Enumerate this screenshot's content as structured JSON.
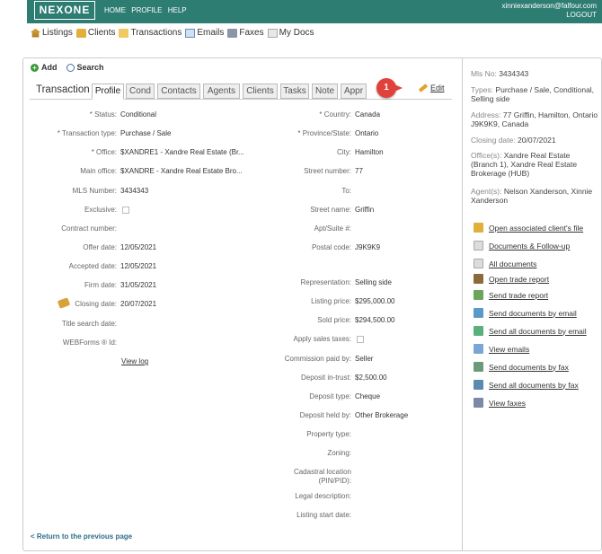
{
  "topbar": {
    "logo": "NEXONE",
    "nav": [
      "HOME",
      "PROFILE",
      "HELP"
    ],
    "user_email": "xinniexanderson@falfour.com",
    "logout": "LOGOUT",
    "bg_color": "#2e7d73"
  },
  "subnav": [
    {
      "label": "Listings",
      "icon": "house-icon"
    },
    {
      "label": "Clients",
      "icon": "clients-icon"
    },
    {
      "label": "Transactions",
      "icon": "folder-icon"
    },
    {
      "label": "Emails",
      "icon": "mail-icon"
    },
    {
      "label": "Faxes",
      "icon": "fax-icon"
    },
    {
      "label": "My Docs",
      "icon": "docs-icon"
    }
  ],
  "tools": {
    "add": "Add",
    "search": "Search"
  },
  "tabs": {
    "title": "Transaction",
    "items": [
      "Profile",
      "Cond",
      "Contacts",
      "Agents",
      "Clients",
      "Tasks",
      "Note",
      "Appr"
    ],
    "active": "Profile"
  },
  "callout": {
    "number": "1",
    "color": "#e0413b"
  },
  "edit_label": "Edit",
  "left_fields": {
    "status": {
      "label": "* Status:",
      "value": "Conditional"
    },
    "transaction_type": {
      "label": "* Transaction type:",
      "value": "Purchase / Sale"
    },
    "office": {
      "label": "* Office:",
      "value": "$XANDRE1 - Xandre Real Estate (Br..."
    },
    "main_office": {
      "label": "Main office:",
      "value": "$XANDRE - Xandre Real Estate Bro..."
    },
    "mls_number": {
      "label": "MLS Number:",
      "value": "3434343"
    },
    "exclusive": {
      "label": "Exclusive:"
    },
    "contract_number": {
      "label": "Contract number:"
    },
    "offer_date": {
      "label": "Offer date:",
      "value": "12/05/2021"
    },
    "accepted_date": {
      "label": "Accepted date:",
      "value": "12/05/2021"
    },
    "firm_date": {
      "label": "Firm date:",
      "value": "31/05/2021"
    },
    "closing_date": {
      "label": "Closing date:",
      "value": "20/07/2021"
    },
    "title_search_date": {
      "label": "Title search date:"
    },
    "webforms_id": {
      "label": "WEBForms ® Id:"
    }
  },
  "view_log": "View log",
  "right_fields": {
    "country": {
      "label": "* Country:",
      "value": "Canada"
    },
    "province": {
      "label": "* Province/State:",
      "value": "Ontario"
    },
    "city": {
      "label": "City:",
      "value": "Hamilton"
    },
    "street_number": {
      "label": "Street number:",
      "value": "77"
    },
    "to": {
      "label": "To:"
    },
    "street_name": {
      "label": "Street name:",
      "value": "Griffin"
    },
    "apt_suite": {
      "label": "Apt/Suite #:"
    },
    "postal_code": {
      "label": "Postal code:",
      "value": "J9K9K9"
    },
    "representation": {
      "label": "Representation:",
      "value": "Selling side"
    },
    "listing_price": {
      "label": "Listing price:",
      "value": "$295,000.00"
    },
    "sold_price": {
      "label": "Sold price:",
      "value": "$294,500.00"
    },
    "apply_sales_taxes": {
      "label": "Apply sales taxes:"
    },
    "commission_paid_by": {
      "label": "Commission paid by:",
      "value": "Seller"
    },
    "deposit_in_trust": {
      "label": "Deposit in-trust:",
      "value": "$2,500.00"
    },
    "deposit_type": {
      "label": "Deposit type:",
      "value": "Cheque"
    },
    "deposit_held_by": {
      "label": "Deposit held by:",
      "value": "Other Brokerage"
    },
    "property_type": {
      "label": "Property type:"
    },
    "zoning": {
      "label": "Zoning:"
    },
    "cadastral_1": {
      "label": "Cadastral location"
    },
    "cadastral_2": {
      "label": "(PIN/PID):"
    },
    "legal_description": {
      "label": "Legal description:"
    },
    "listing_start_date": {
      "label": "Listing start date:"
    }
  },
  "back_link": "< Return to the previous page",
  "summary": {
    "mls_label": "Mls No:",
    "mls_value": "3434343",
    "types_label": "Types:",
    "types_value": "Purchase / Sale, Conditional, Selling side",
    "address_label": "Address:",
    "address_value": "77 Griffin, Hamilton, Ontario J9K9K9, Canada",
    "closing_label": "Closing date:",
    "closing_value": "20/07/2021",
    "offices_label": "Office(s):",
    "offices_value": "Xandre Real Estate (Branch 1), Xandre Real Estate Brokerage (HUB)",
    "agents_label": "Agent(s):",
    "agents_value": "Nelson Xanderson, Xinnie Xanderson"
  },
  "actions": [
    {
      "label": "Open associated client's file",
      "icon": "client-file-icon",
      "color": "#e1b03a"
    },
    {
      "label": "Documents & Follow-up",
      "icon": "documents-icon",
      "color": "#dcdcdc"
    },
    {
      "label": "All documents",
      "icon": "all-documents-icon",
      "color": "#dcdcdc"
    },
    {
      "label": "Open trade report",
      "icon": "trade-report-icon",
      "color": "#8a6a3a"
    },
    {
      "label": "Send trade report",
      "icon": "send-trade-report-icon",
      "color": "#6aa55a"
    },
    {
      "label": "Send documents by email",
      "icon": "email-documents-icon",
      "color": "#5a9ac9"
    },
    {
      "label": "Send all documents by email",
      "icon": "email-all-documents-icon",
      "color": "#5ab07a"
    },
    {
      "label": "View emails",
      "icon": "view-emails-icon",
      "color": "#7aa6d6"
    },
    {
      "label": "Send documents by fax",
      "icon": "fax-documents-icon",
      "color": "#6a9a7a"
    },
    {
      "label": "Send all documents by fax",
      "icon": "fax-all-documents-icon",
      "color": "#5a8ab0"
    },
    {
      "label": "View faxes",
      "icon": "view-faxes-icon",
      "color": "#7a8aa6"
    }
  ]
}
